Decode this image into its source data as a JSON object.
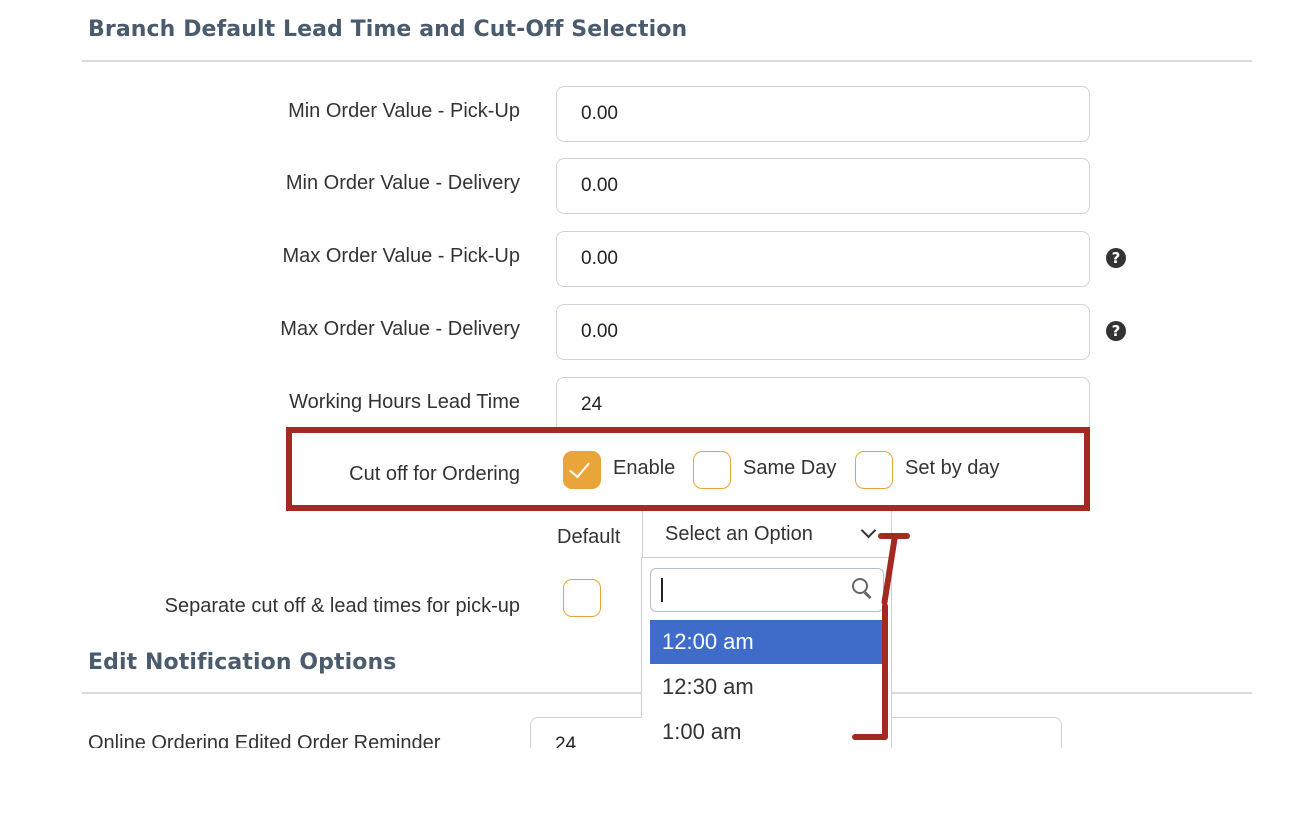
{
  "section_lead": {
    "title": "Branch Default Lead Time and Cut-Off Selection"
  },
  "fields": [
    {
      "label": "Min Order Value - Pick-Up",
      "value": "0.00"
    },
    {
      "label": "Min Order Value - Delivery",
      "value": "0.00"
    },
    {
      "label": "Max Order Value - Pick-Up",
      "value": "0.00",
      "help": "?"
    },
    {
      "label": "Max Order Value - Delivery",
      "value": "0.00",
      "help": "?"
    },
    {
      "label": "Working Hours Lead Time",
      "value": "24"
    }
  ],
  "cutoff": {
    "label": "Cut off for Ordering",
    "options": [
      {
        "label": "Enable",
        "checked": true
      },
      {
        "label": "Same Day",
        "checked": false
      },
      {
        "label": "Set by day",
        "checked": false
      }
    ],
    "default_label": "Default",
    "select_value": "Select an Option",
    "dropdown": {
      "search_value": "",
      "options": [
        "12:00 am",
        "12:30 am",
        "1:00 am"
      ],
      "highlighted": "12:00 am"
    }
  },
  "separate": {
    "label": "Separate cut off & lead times for pick-up",
    "checked": false
  },
  "section_notify": {
    "title": "Edit Notification Options"
  },
  "reminder": {
    "label": "Online Ordering Edited Order Reminder",
    "value": "24"
  },
  "colors": {
    "accent_orange": "#e9a53a",
    "annotation_red": "#a32a20",
    "highlight_blue": "#3f6cc9",
    "heading_slate": "#4a5b6e"
  }
}
